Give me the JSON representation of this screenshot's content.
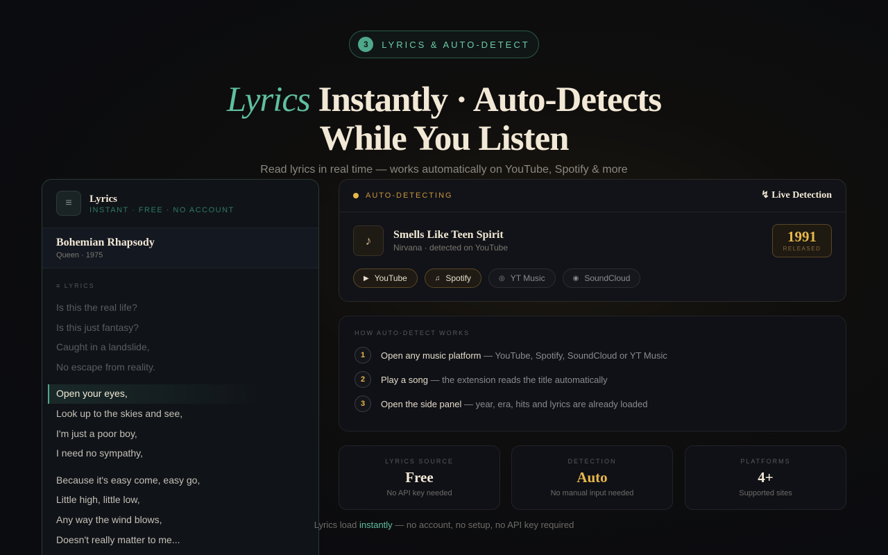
{
  "step": {
    "number": "3",
    "label": "LYRICS & AUTO-DETECT"
  },
  "hero": {
    "accent": "Lyrics",
    "line1_rest": " Instantly · Auto-Detects",
    "line2": "While You Listen",
    "subtitle": "Read lyrics in real time — works automatically on YouTube, Spotify & more"
  },
  "lyrics_panel": {
    "icon": "menu-icon",
    "title": "Lyrics",
    "tagline": "INSTANT · FREE · NO ACCOUNT",
    "song_title": "Bohemian Rhapsody",
    "song_meta": "Queen · 1975",
    "section_label": "≡ LYRICS",
    "past_lines": [
      "Is this the real life?",
      "Is this just fantasy?",
      "Caught in a landslide,",
      "No escape from reality."
    ],
    "current_line": "Open your eyes,",
    "next_lines": [
      "Look up to the skies and see,",
      "I'm just a poor boy,",
      "I need no sympathy,"
    ],
    "later_lines": [
      "Because it's easy come, easy go,",
      "Little high, little low,",
      "Any way the wind blows,",
      "Doesn't really matter to me..."
    ]
  },
  "detect": {
    "status": "AUTO-DETECTING",
    "live_label": "↯ Live Detection",
    "song": "Smells Like Teen Spirit",
    "meta": "Nirvana · detected on YouTube",
    "year": "1991",
    "year_label": "RELEASED",
    "platforms": [
      {
        "name": "YouTube",
        "icon": "▶",
        "active": true
      },
      {
        "name": "Spotify",
        "icon": "♫",
        "active": true
      },
      {
        "name": "YT Music",
        "icon": "◎",
        "active": false
      },
      {
        "name": "SoundCloud",
        "icon": "◉",
        "active": false
      }
    ],
    "status_color": "#e8b84a"
  },
  "how": {
    "label": "HOW AUTO-DETECT WORKS",
    "steps": [
      {
        "num": "1",
        "bold": "Open any music platform",
        "rest": " — YouTube, Spotify, SoundCloud or YT Music"
      },
      {
        "num": "2",
        "bold": "Play a song",
        "rest": " — the extension reads the title automatically"
      },
      {
        "num": "3",
        "bold": "Open the side panel",
        "rest": " — year, era, hits and lyrics are already loaded"
      }
    ]
  },
  "stats": [
    {
      "label": "LYRICS SOURCE",
      "value": "Free",
      "sub": "No API key needed",
      "color": "#f2e8d6"
    },
    {
      "label": "DETECTION",
      "value": "Auto",
      "sub": "No manual input needed",
      "color": "#e8b84a"
    },
    {
      "label": "PLATFORMS",
      "value": "4+",
      "sub": "Supported sites",
      "color": "#f2e8d6"
    }
  ],
  "footer": {
    "pre": "Lyrics load ",
    "highlight": "instantly",
    "post": " — no account, no setup, no API key required"
  },
  "colors": {
    "accent": "#5fbf9f",
    "gold": "#e8b84a"
  }
}
